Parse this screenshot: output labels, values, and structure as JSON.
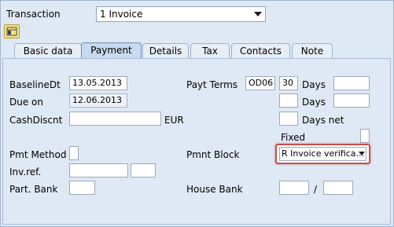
{
  "header": {
    "transaction_label": "Transaction",
    "transaction_value": "1 Invoice"
  },
  "toolbar": {
    "icon": "layout-toggle-icon"
  },
  "tabs": [
    "Basic data",
    "Payment",
    "Details",
    "Tax",
    "Contacts",
    "Note"
  ],
  "active_tab": "Payment",
  "form": {
    "baseline_dt": {
      "label": "BaselineDt",
      "value": "13.05.2013"
    },
    "due_on": {
      "label": "Due on",
      "value": "12.06.2013"
    },
    "cash_discnt": {
      "label": "CashDiscnt",
      "value": "",
      "currency": "EUR"
    },
    "pmt_method": {
      "label": "Pmt Method",
      "value": ""
    },
    "inv_ref": {
      "label": "Inv.ref.",
      "value": "",
      "value2": ""
    },
    "part_bank": {
      "label": "Part. Bank",
      "value": ""
    },
    "payt_terms": {
      "label": "Payt Terms",
      "value": "OD06"
    },
    "days1": {
      "label": "Days",
      "days": "30",
      "pct": ""
    },
    "days2": {
      "label": "Days",
      "days": "",
      "pct": ""
    },
    "days_net": {
      "label": "Days net",
      "value": ""
    },
    "fixed": {
      "label": "Fixed"
    },
    "pmnt_block": {
      "label": "Pmnt Block",
      "value": "R Invoice verifica..."
    },
    "house_bank": {
      "label": "House Bank",
      "value1": "",
      "separator": "/",
      "value2": ""
    }
  },
  "colors": {
    "background": "#dfe9f5",
    "active_tab": "#c7daef",
    "highlight": "#c0504d"
  }
}
